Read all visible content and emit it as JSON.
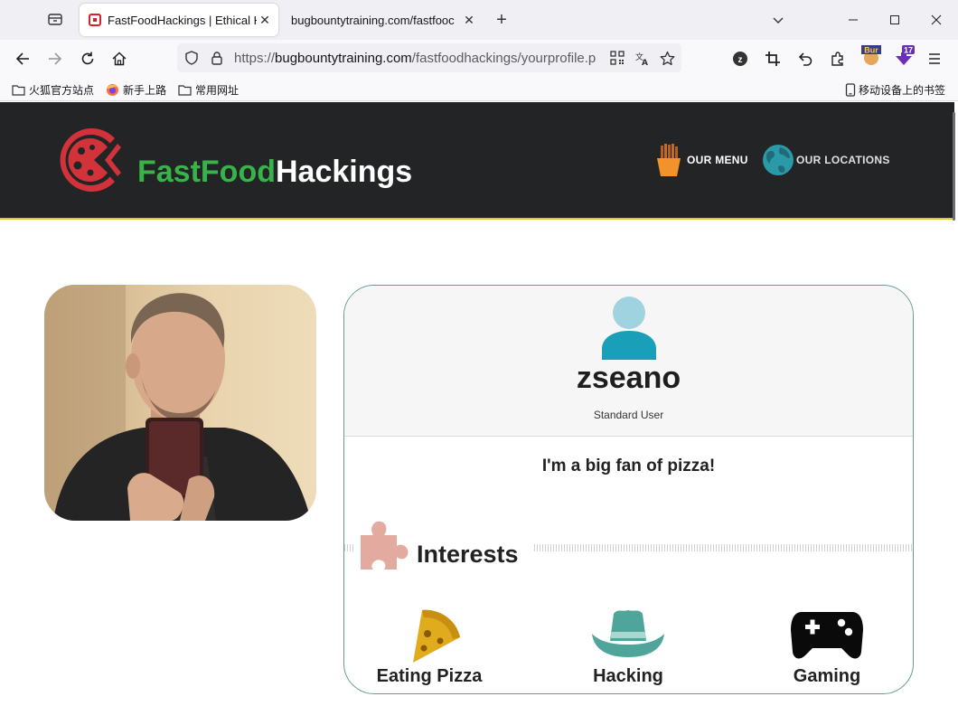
{
  "browser": {
    "tabs": [
      {
        "title": "FastFoodHackings | Ethical H",
        "active": true
      },
      {
        "title": "bugbountytraining.com/fastfooc",
        "active": false
      }
    ],
    "url": {
      "scheme": "https://",
      "host": "bugbountytraining.com",
      "path": "/fastfoodhackings/yourprofile.p"
    },
    "bookmarks": [
      "火狐官方站点",
      "新手上路",
      "常用网址"
    ],
    "mobile_bookmarks": "移动设备上的书签",
    "extensions": {
      "burp_label": "Bur",
      "badge_count": "17"
    }
  },
  "site": {
    "logo": {
      "part1": "FastFood",
      "part2": "Hackings"
    },
    "nav": [
      {
        "label": "OUR MENU",
        "icon": "fries-icon"
      },
      {
        "label": "OUR LOCATIONS",
        "icon": "globe-icon"
      }
    ],
    "colors": {
      "header_bg": "#232425",
      "brand_green": "#37b34a",
      "card_border": "#5f9e93"
    }
  },
  "profile": {
    "username": "zseano",
    "role": "Standard User",
    "bio": "I'm a big fan of pizza!",
    "interests_title": "Interests",
    "interests": [
      {
        "label": "Eating Pizza",
        "icon": "pizza-icon"
      },
      {
        "label": "Hacking",
        "icon": "cowboy-hat-icon"
      },
      {
        "label": "Gaming",
        "icon": "gamepad-icon"
      }
    ]
  }
}
